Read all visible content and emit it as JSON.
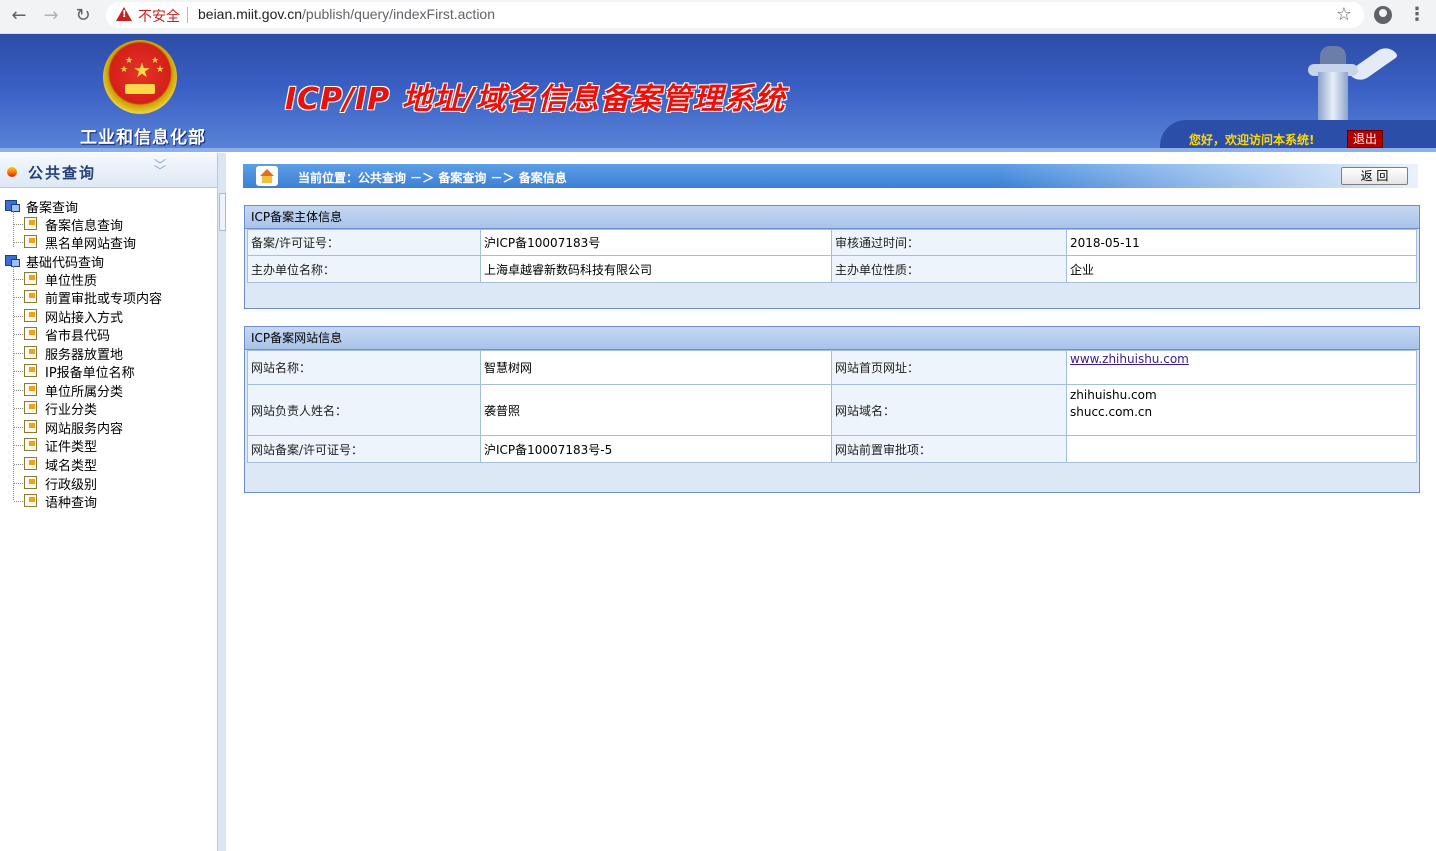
{
  "browser": {
    "insecure_label": "不安全",
    "url_host": "beian.miit.gov.cn",
    "url_path": "/publish/query/indexFirst.action"
  },
  "header": {
    "ministry": "工业和信息化部",
    "system_title": "ICP/IP 地址/域名信息备案管理系统",
    "welcome": "您好，欢迎访问本系统!",
    "logout": "退出"
  },
  "sidebar": {
    "title": "公共查询",
    "groups": [
      {
        "label": "备案查询",
        "items": [
          "备案信息查询",
          "黑名单网站查询"
        ]
      },
      {
        "label": "基础代码查询",
        "items": [
          "单位性质",
          "前置审批或专项内容",
          "网站接入方式",
          "省市县代码",
          "服务器放置地",
          "IP报备单位名称",
          "单位所属分类",
          "行业分类",
          "网站服务内容",
          "证件类型",
          "域名类型",
          "行政级别",
          "语种查询"
        ]
      }
    ]
  },
  "breadcrumb": {
    "text": "当前位置：公共查询 －＞ 备案查询 －＞ 备案信息",
    "back_label": "返 回"
  },
  "subject_panel": {
    "title": "ICP备案主体信息",
    "rows": [
      [
        "备案/许可证号：",
        "沪ICP备10007183号",
        "审核通过时间：",
        "2018-05-11"
      ],
      [
        "主办单位名称：",
        "上海卓越睿新数码科技有限公司",
        "主办单位性质：",
        "企业"
      ]
    ]
  },
  "site_panel": {
    "title": "ICP备案网站信息",
    "site_name_label": "网站名称：",
    "site_name": "智慧树网",
    "homepage_label": "网站首页网址：",
    "homepage": "www.zhihuishu.com",
    "owner_label": "网站负责人姓名：",
    "owner": "袭普照",
    "domain_label": "网站域名：",
    "domain_1": "zhihuishu.com",
    "domain_2": "shucc.com.cn",
    "license_label": "网站备案/许可证号：",
    "license": "沪ICP备10007183号-5",
    "preapproval_label": "网站前置审批项：",
    "preapproval": ""
  }
}
